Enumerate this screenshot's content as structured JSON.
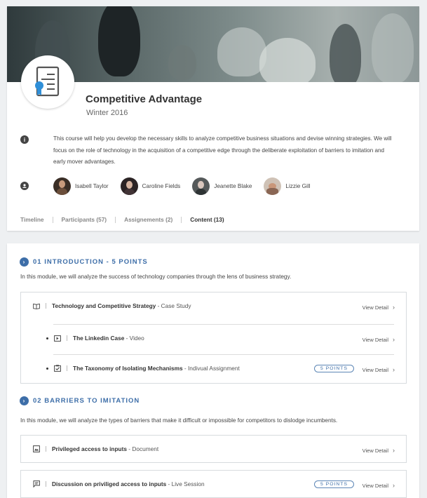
{
  "course": {
    "title": "Competitive Advantage",
    "term": "Winter 2016",
    "description": "This course will help you develop the necessary skills to analyze competitive business situations and devise winning strategies. We will focus on the role of technology in the acquisition of a competitive edge through the deliberate exploitation of barriers to imitation and early mover advantages.",
    "participants": [
      {
        "name": "Isabell Taylor"
      },
      {
        "name": "Caroline Fields"
      },
      {
        "name": "Jeanette Blake"
      },
      {
        "name": "Lizzie Gill"
      }
    ],
    "tabs": [
      {
        "label": "Timeline"
      },
      {
        "label": "Participants (57)"
      },
      {
        "label": "Assignements (2)"
      },
      {
        "label": "Content (13)",
        "active": true
      }
    ]
  },
  "modules": [
    {
      "heading": "01 INTRODUCTION - 5 POINTS",
      "description": "In this module, we will analyze the success of technology companies through the lens of business strategy.",
      "items": [
        {
          "title": "Technology and Competitive Strategy",
          "type": " - Case Study",
          "action": "View Detail",
          "icon": "book-icon"
        },
        {
          "title": "The Linkedin Case",
          "type": " - Video",
          "action": "View Detail",
          "icon": "video-icon"
        },
        {
          "title": "The Taxonomy of Isolating Mechanisms",
          "type": " - Indivual Assignment",
          "action": "View Detail",
          "badge": "5 POINTS",
          "icon": "assignment-icon"
        }
      ]
    },
    {
      "heading": "02 BARRIERS TO IMITATION",
      "description": "In this module, we will analyze the types of barriers that make it difficult or impossible for competitors to dislodge incumbents.",
      "items": [
        {
          "title": "Privileged access to inputs",
          "type": " - Document",
          "action": "View Detail",
          "icon": "document-icon"
        },
        {
          "title": "Discussion on priviliged access to inputs",
          "type": " - Live Session",
          "action": "View Detail",
          "badge": "5 POINTS",
          "icon": "live-session-icon"
        }
      ]
    }
  ],
  "colors": {
    "accent": "#3d6ea8",
    "page_bg": "#eef0f2"
  }
}
